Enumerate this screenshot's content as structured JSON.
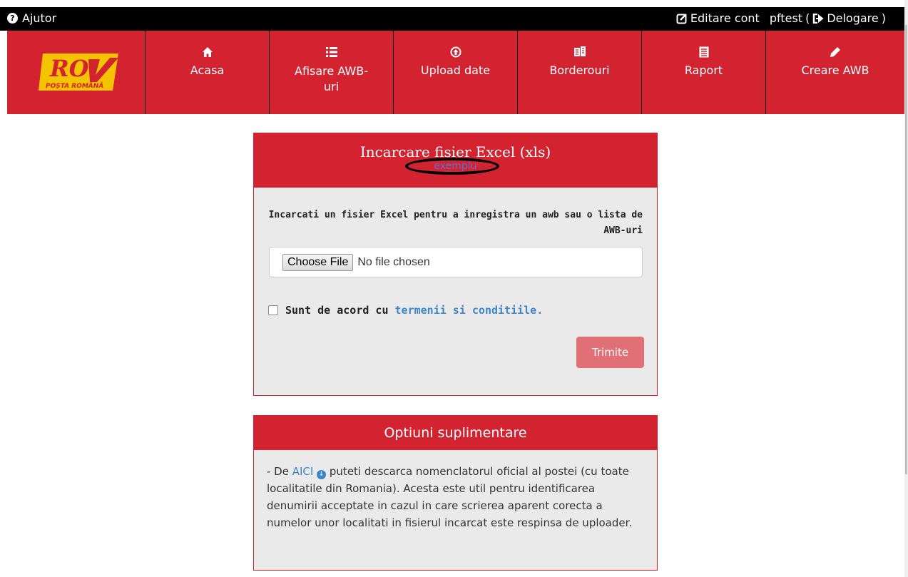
{
  "topbar": {
    "help_label": "Ajutor",
    "edit_label": "Editare cont",
    "username": "pftest",
    "open_paren": "(",
    "logout_label": "Delogare",
    "close_paren": ")"
  },
  "logo": {
    "brand": "RO",
    "subtitle": "POȘTA ROMÂNĂ",
    "colors": {
      "yellow": "#f5c400",
      "red": "#d32330"
    }
  },
  "nav": {
    "items": [
      {
        "label": "Acasa",
        "icon": "home-icon"
      },
      {
        "label": "Afisare AWB-uri",
        "icon": "list-icon"
      },
      {
        "label": "Upload date",
        "icon": "upload-icon"
      },
      {
        "label": "Borderouri",
        "icon": "documents-icon"
      },
      {
        "label": "Raport",
        "icon": "report-icon"
      },
      {
        "label": "Creare AWB",
        "icon": "pencil-icon"
      }
    ]
  },
  "upload_panel": {
    "title": "Incarcare fisier Excel (xls)",
    "example_link": "exemplu",
    "description": "Incarcati un fisier Excel pentru a inregistra un awb sau o lista de AWB-uri",
    "choose_file_label": "Choose File",
    "file_status": "No file chosen",
    "agree_text": "Sunt de acord cu",
    "terms_link": "termenii si conditiile.",
    "submit_label": "Trimite"
  },
  "options_panel": {
    "title": "Optiuni suplimentare",
    "text_prefix": "- De",
    "aici_link": "AICI",
    "text_rest": "puteti descarca nomenclatorul oficial al postei (cu toate localitatile din Romania). Acesta este util pentru identificarea denumirii acceptate in cazul in care scrierea aparent corecta a numelor unor localitati in fisierul incarcat este respinsa de uploader."
  },
  "colors": {
    "primary_red": "#d32330",
    "link_blue": "#3f86c8",
    "submit_disabled": "#e06f77"
  }
}
